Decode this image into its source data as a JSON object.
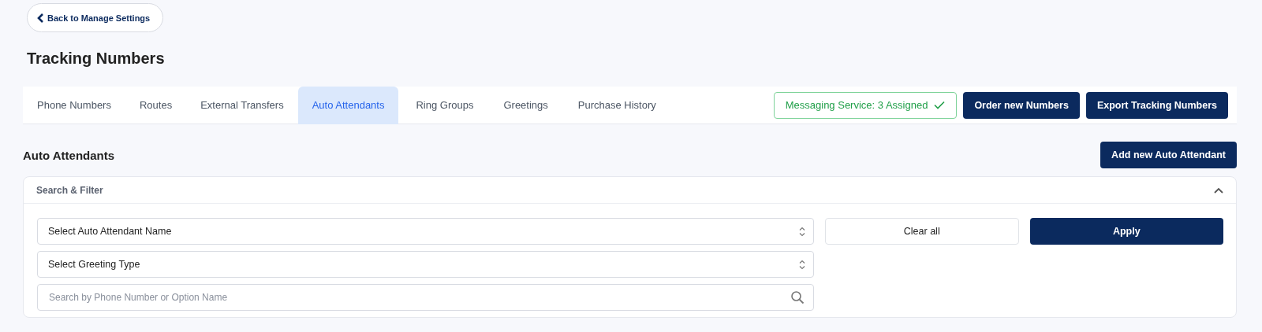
{
  "back_button": {
    "label": "Back to Manage Settings"
  },
  "page_title": "Tracking Numbers",
  "tabs": [
    {
      "label": "Phone Numbers",
      "selected": false
    },
    {
      "label": "Routes",
      "selected": false
    },
    {
      "label": "External Transfers",
      "selected": false
    },
    {
      "label": "Auto Attendants",
      "selected": true
    },
    {
      "label": "Ring Groups",
      "selected": false
    },
    {
      "label": "Greetings",
      "selected": false
    },
    {
      "label": "Purchase History",
      "selected": false
    }
  ],
  "messaging_status": "Messaging Service: 3 Assigned",
  "header_buttons": [
    "Order new Numbers",
    "Export Tracking Numbers"
  ],
  "section": {
    "title": "Auto Attendants",
    "add_button": "Add new Auto Attendant"
  },
  "filter": {
    "title": "Search & Filter",
    "expanded": true,
    "fields": [
      {
        "kind": "select",
        "value": "Select Auto Attendant Name"
      },
      {
        "kind": "select",
        "value": "Select Greeting Type"
      },
      {
        "kind": "search",
        "placeholder": "Search by Phone Number or Option Name"
      }
    ],
    "clear_button": "Clear all",
    "apply_button": "Apply"
  }
}
